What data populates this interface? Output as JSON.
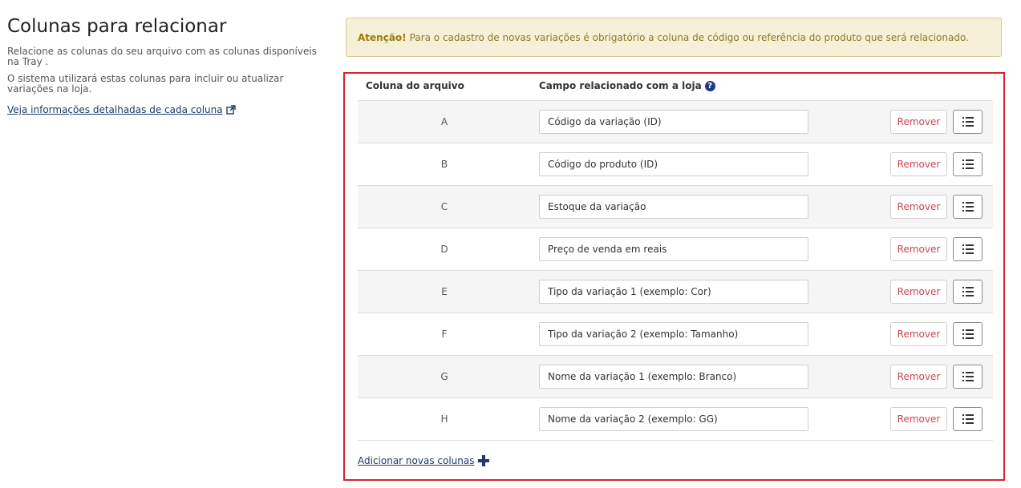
{
  "left": {
    "title": "Colunas para relacionar",
    "desc1": "Relacione as colunas do seu arquivo com as colunas disponíveis na Tray .",
    "desc2": "O sistema utilizará estas colunas para incluir ou atualizar variações na loja.",
    "info_link": "Veja informações detalhadas de cada coluna",
    "info_link_icon": "external-link-icon"
  },
  "alert": {
    "strong": "Atenção!",
    "text": "Para o cadastro de novas variações é obrigatório a coluna de código ou referência do produto que será relacionado."
  },
  "table": {
    "col_header": "Coluna do arquivo",
    "field_header": "Campo relacionado com a loja",
    "help_icon": "?",
    "remove_label": "Remover",
    "rows": [
      {
        "col": "A",
        "field": "Código da variação (ID)"
      },
      {
        "col": "B",
        "field": "Código do produto (ID)"
      },
      {
        "col": "C",
        "field": "Estoque da variação"
      },
      {
        "col": "D",
        "field": "Preço de venda em reais"
      },
      {
        "col": "E",
        "field": "Tipo da variação 1 (exemplo: Cor)"
      },
      {
        "col": "F",
        "field": "Tipo da variação 2 (exemplo: Tamanho)"
      },
      {
        "col": "G",
        "field": "Nome da variação 1 (exemplo: Branco)"
      },
      {
        "col": "H",
        "field": "Nome da variação 2 (exemplo: GG)"
      }
    ]
  },
  "add_columns": {
    "label": "Adicionar novas colunas",
    "icon": "plus-icon"
  },
  "colors": {
    "highlight_border": "#d9232e",
    "link": "#1f3a6b",
    "remove_text": "#c8464d",
    "alert_bg": "#f5f0d7"
  }
}
